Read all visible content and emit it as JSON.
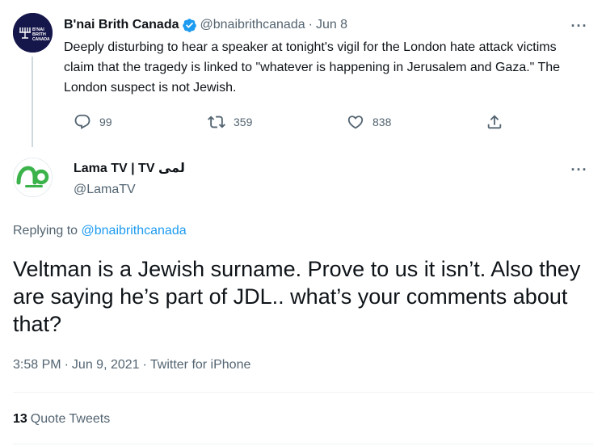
{
  "parent_tweet": {
    "author_name": "B'nai Brith Canada",
    "verified": true,
    "handle": "@bnaibrithcanada",
    "separator": "·",
    "date": "Jun 8",
    "avatar_text": [
      "B'NAI",
      "BRITH",
      "CANADA"
    ],
    "text": "Deeply disturbing to hear a speaker at tonight's vigil for the London hate attack victims claim that the tragedy is linked to \"whatever is happening in Jerusalem and Gaza.\" The London suspect is not Jewish.",
    "replies": "99",
    "retweets": "359",
    "likes": "838",
    "icons": [
      "reply-icon",
      "retweet-icon",
      "like-icon",
      "share-icon",
      "more-icon"
    ]
  },
  "reply_tweet": {
    "author_name": "Lama TV | TV لمى",
    "handle": "@LamaTV",
    "replying_prefix": "Replying to",
    "replying_handle": "@bnaibrithcanada",
    "text": "Veltman is a Jewish surname. Prove to us it isn’t. Also they are saying he’s part of JDL.. what’s your comments about that?",
    "time": "3:58 PM",
    "date": "Jun 9, 2021",
    "source": "Twitter for iPhone",
    "separator": "·",
    "quote_count": "13",
    "quote_label": "Quote Tweets"
  },
  "colors": {
    "primary_text": "#0f1419",
    "secondary_text": "#536471",
    "link": "#1d9bf0",
    "verified_badge": "#1d9bf0",
    "lama_green": "#3bb34a",
    "bnai_navy": "#15164a"
  }
}
